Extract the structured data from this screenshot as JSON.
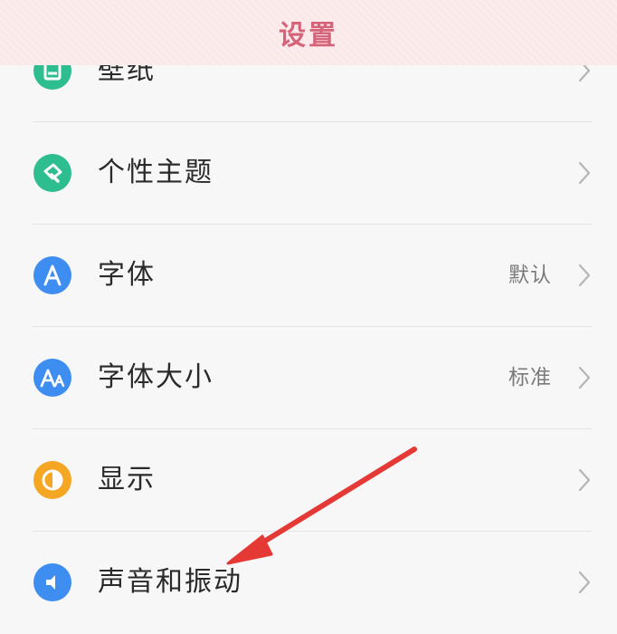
{
  "header": {
    "title": "设置"
  },
  "colors": {
    "header_bg": "#fbe9ea",
    "title": "#d5647a",
    "arrow": "#e53935",
    "icon_green": "#2ebd8e",
    "icon_blue": "#3d8ef0",
    "icon_orange": "#f5a623"
  },
  "settings": {
    "items": [
      {
        "label": "壁纸",
        "value": "",
        "icon": "wallpaper-icon"
      },
      {
        "label": "个性主题",
        "value": "",
        "icon": "theme-brush-icon"
      },
      {
        "label": "字体",
        "value": "默认",
        "icon": "font-a-icon"
      },
      {
        "label": "字体大小",
        "value": "标准",
        "icon": "font-size-icon"
      },
      {
        "label": "显示",
        "value": "",
        "icon": "display-contrast-icon"
      },
      {
        "label": "声音和振动",
        "value": "",
        "icon": "sound-icon"
      }
    ]
  },
  "annotation": {
    "type": "red-arrow",
    "points_to": "声音和振动"
  }
}
